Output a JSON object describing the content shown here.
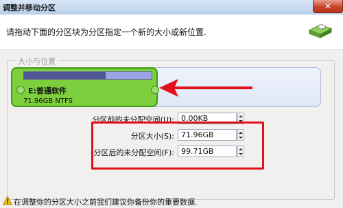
{
  "window": {
    "title": "调整并移动分区",
    "close_symbol": "✕"
  },
  "header": {
    "instruction": "请拖动下面的分区块为分区指定一个新的大小或新位置.",
    "icon": "drive-icon"
  },
  "group": {
    "legend": "大小与位置"
  },
  "partition": {
    "name": "E:普通软件",
    "info": "71.96GB NTFS",
    "used_fraction": 0.64,
    "color": "#7ecf3e"
  },
  "fields": [
    {
      "label": "分区前的未分配空间(U):",
      "value": "0.00KB"
    },
    {
      "label": "分区大小(S):",
      "value": "71.96GB"
    },
    {
      "label": "分区后的未分配空间(F):",
      "value": "99.71GB"
    }
  ],
  "warning": {
    "icon": "warning-icon",
    "text": "在调整你的分区大小之前我们建议你备份你的重要数据."
  },
  "accents": {
    "annotation_red": "#e1101c"
  }
}
